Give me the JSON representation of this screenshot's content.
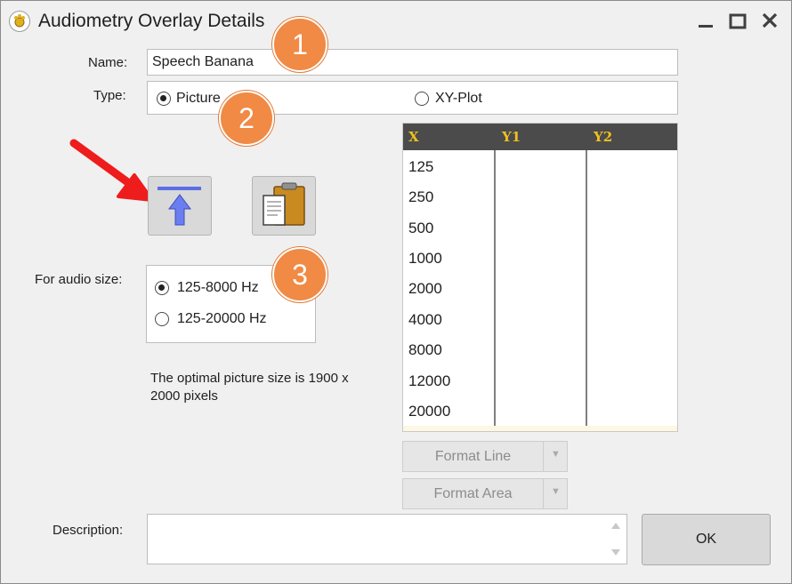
{
  "window": {
    "title": "Audiometry Overlay Details"
  },
  "form": {
    "name_label": "Name:",
    "name_value": "Speech Banana",
    "type_label": "Type:",
    "type_options": [
      "Picture",
      "XY-Plot"
    ],
    "type_selected": "Picture",
    "audio_size_label": "For audio size:",
    "audio_size_options": [
      "125-8000 Hz",
      "125-20000 Hz"
    ],
    "audio_size_selected": "125-8000 Hz",
    "optimal_note": "The optimal picture size is 1900 x 2000 pixels",
    "description_label": "Description:",
    "description_value": ""
  },
  "grid": {
    "headers": [
      "X",
      "Y1",
      "Y2"
    ],
    "x_values": [
      "125",
      "250",
      "500",
      "1000",
      "2000",
      "4000",
      "8000",
      "12000",
      "20000"
    ]
  },
  "buttons": {
    "format_line": "Format Line",
    "format_area": "Format Area",
    "ok": "OK"
  },
  "annotations": {
    "badges": [
      "1",
      "2",
      "3"
    ]
  },
  "colors": {
    "header_bg": "#4b4b4b",
    "header_text": "#f0c020",
    "badge": "#f08a45",
    "arrow": "#ee1c1c",
    "upload_arrow": "#5a6ee6"
  }
}
